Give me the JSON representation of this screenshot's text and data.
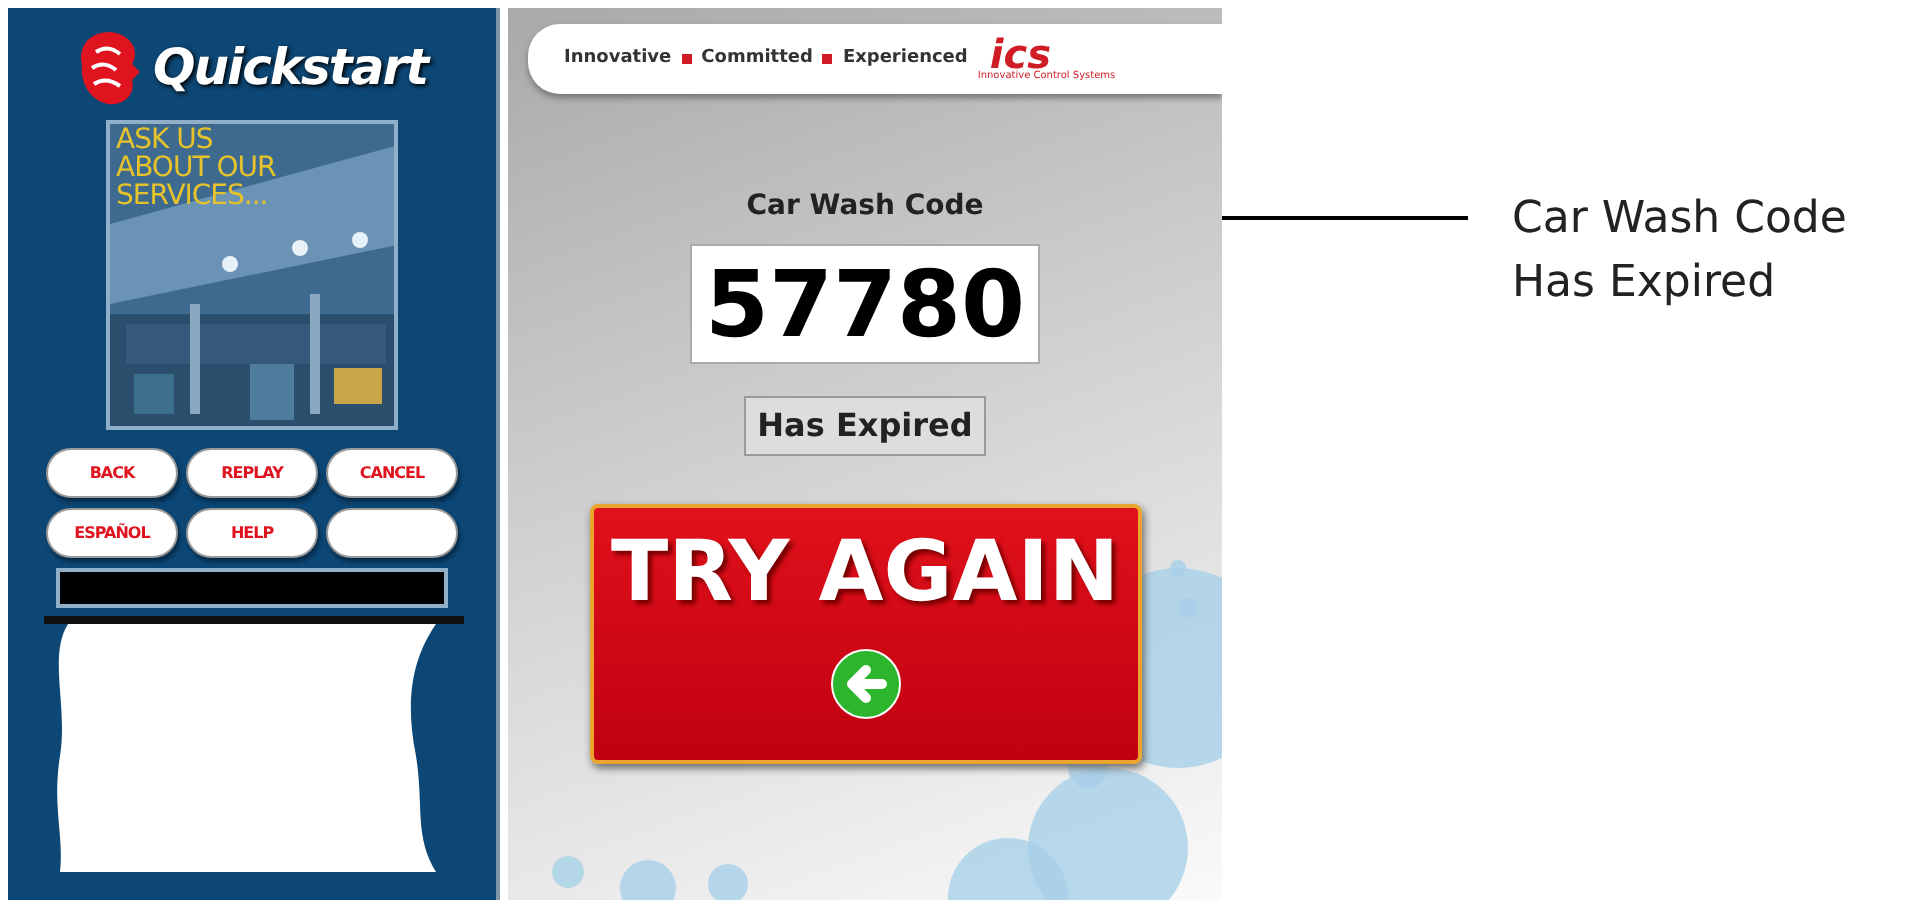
{
  "kiosk": {
    "logo": "Quickstart",
    "promo": {
      "kind": "picture",
      "lines": [
        "ASK US",
        "ABOUT OUR",
        "SERVICES..."
      ]
    },
    "buttons": [
      {
        "kind": "label",
        "label": "BACK"
      },
      {
        "kind": "label",
        "label": "REPLAY"
      },
      {
        "kind": "label",
        "label": "CANCEL"
      },
      {
        "kind": "label",
        "label": "ESPAÑOL"
      },
      {
        "kind": "label",
        "label": "HELP"
      },
      {
        "kind": "blank"
      }
    ]
  },
  "screen": {
    "tagline": [
      "Innovative",
      "Committed",
      "Experienced"
    ],
    "brand": "ics",
    "brand_sub": "Innovative Control Systems",
    "code_label": "Car Wash Code",
    "code": "57780",
    "status": "Has Expired",
    "action": "TRY AGAIN"
  },
  "callout": {
    "lines": [
      "Car Wash Code",
      "Has Expired"
    ]
  }
}
